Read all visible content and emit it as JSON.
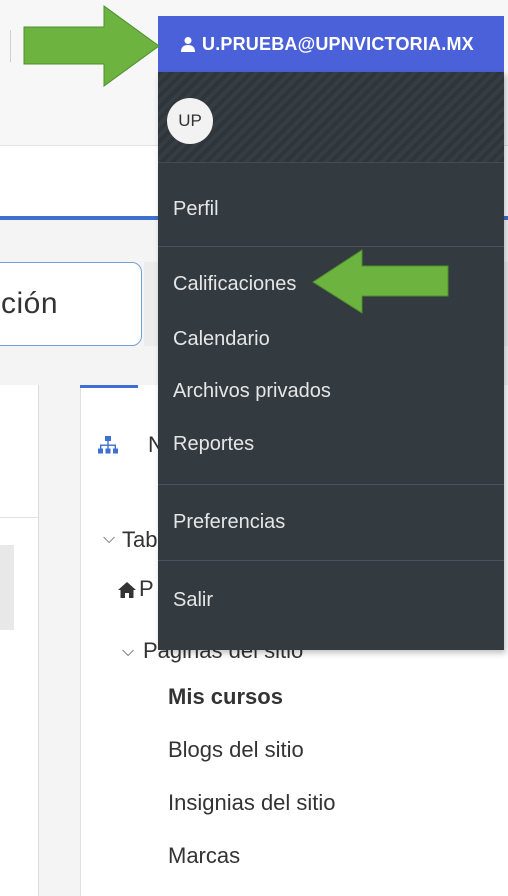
{
  "user_menu": {
    "email": "U.PRUEBA@UPNVICTORIA.MX",
    "avatar_initials": "UP",
    "items": [
      {
        "label": "Perfil"
      },
      {
        "label": "Calificaciones"
      },
      {
        "label": "Calendario"
      },
      {
        "label": "Archivos privados"
      },
      {
        "label": "Reportes"
      },
      {
        "label": "Preferencias"
      },
      {
        "label": "Salir"
      }
    ]
  },
  "search": {
    "visible_text": "ción"
  },
  "nav_block": {
    "title_partial": "N",
    "tree": {
      "root_partial": "Tab",
      "home_partial": "P",
      "site_pages_partial": "Páginas del sitio",
      "items": [
        {
          "label": "Mis cursos",
          "bold": true
        },
        {
          "label": "Blogs del sitio"
        },
        {
          "label": "Insignias del sitio"
        },
        {
          "label": "Marcas"
        }
      ]
    }
  },
  "colors": {
    "menu_header": "#4b61d9",
    "menu_bg": "#333a40",
    "arrow": "#6db33f",
    "accent": "#3f6fd1"
  },
  "icons": {
    "user": "user-icon",
    "sitemap": "sitemap-icon",
    "home": "home-icon",
    "chevron": "chevron-down-icon",
    "annotation": "green-arrow"
  }
}
